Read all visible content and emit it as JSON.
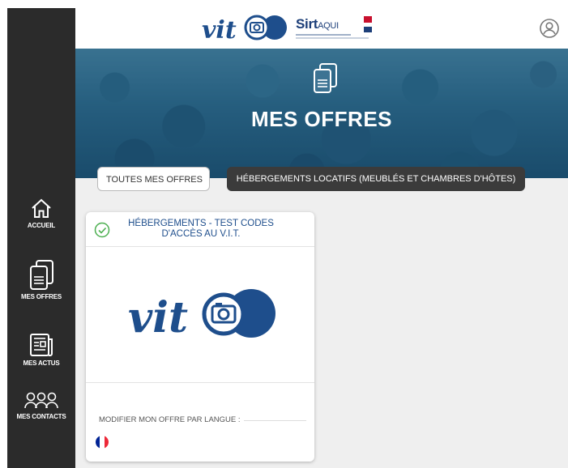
{
  "header": {
    "brand_logo_text": "vit",
    "partner_name": "Sirt",
    "partner_suffix": "AQUI"
  },
  "sidebar": {
    "items": [
      {
        "label": "ACCUEIL",
        "icon": "home-icon"
      },
      {
        "label": "MES OFFRES",
        "icon": "documents-icon"
      },
      {
        "label": "MES ACTUS",
        "icon": "news-icon"
      },
      {
        "label": "MES CONTACTS",
        "icon": "contacts-icon"
      }
    ]
  },
  "hero": {
    "title": "MES OFFRES",
    "icon": "documents-icon"
  },
  "filters": [
    {
      "label": "TOUTES MES OFFRES",
      "selected": false
    },
    {
      "label": "HÉBERGEMENTS LOCATIFS (MEUBLÉS ET CHAMBRES D'HÔTES)",
      "selected": true
    }
  ],
  "card": {
    "title": "HÉBERGEMENTS - TEST CODES D'ACCÈS AU V.I.T.",
    "status_icon": "check-circle-icon",
    "logo_text": "vit",
    "lang_label": "MODIFIER MON OFFRE PAR LANGUE :",
    "languages": [
      {
        "code": "fr",
        "flag_colors": [
          "#002395",
          "#ffffff",
          "#ed2939"
        ]
      }
    ]
  },
  "colors": {
    "sidebar_bg": "#2b2b2b",
    "brand_blue": "#1e4e8c",
    "content_bg": "#efefef",
    "active_filter_bg": "#3b3b3b"
  }
}
